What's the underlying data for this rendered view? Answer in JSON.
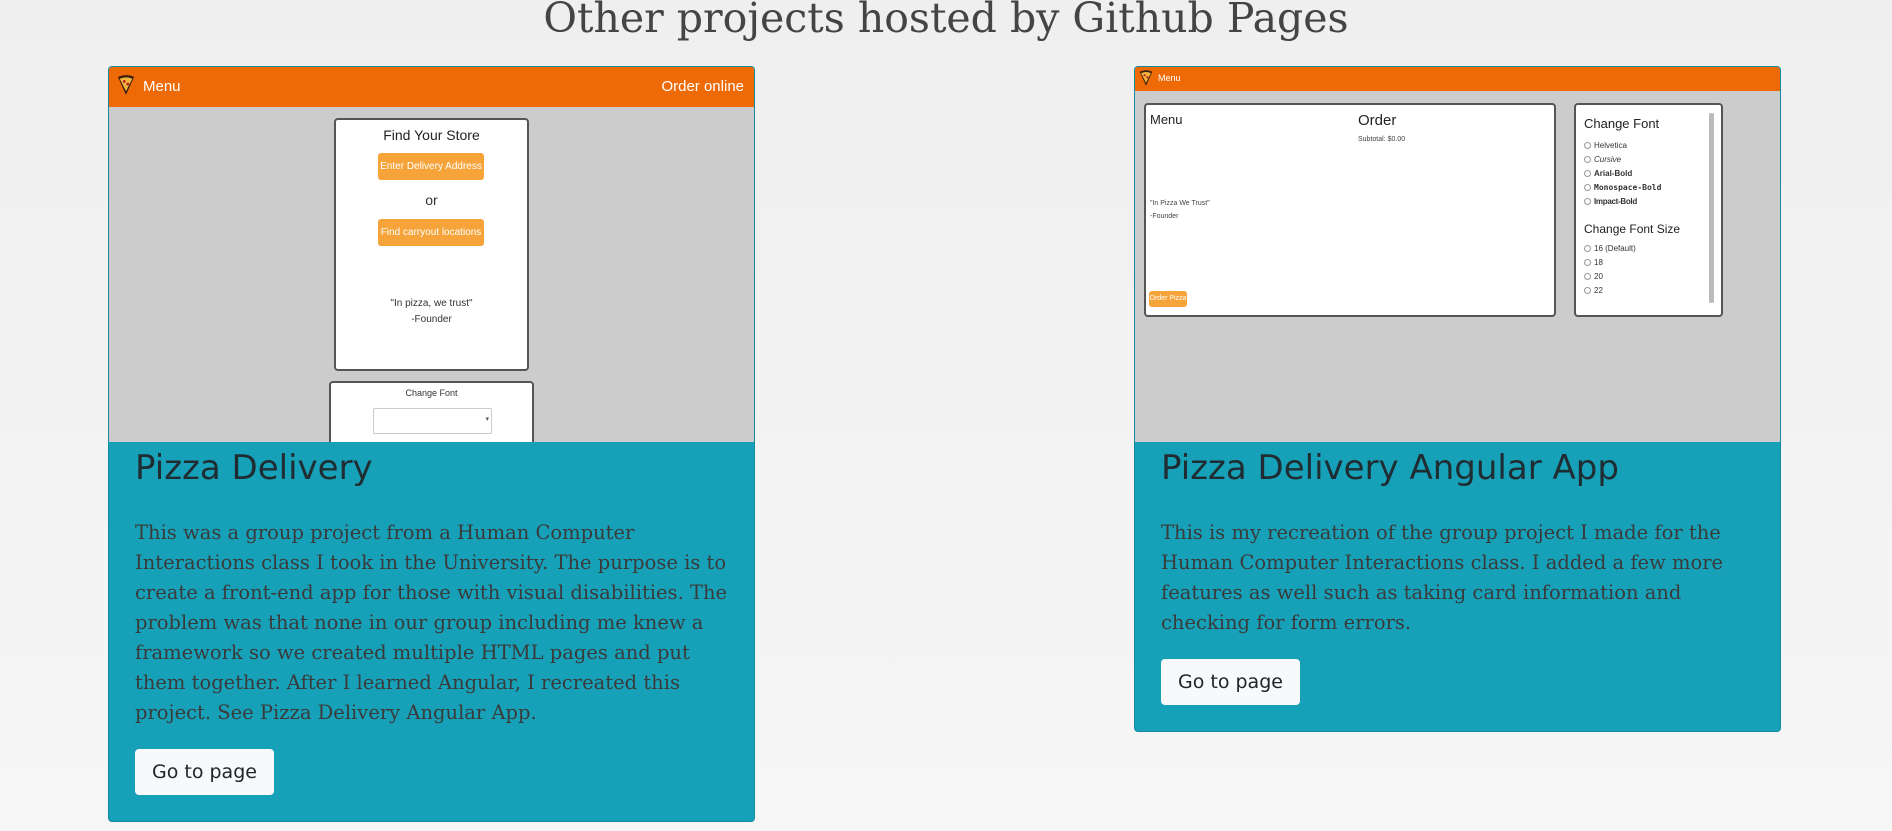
{
  "page": {
    "heading": "Other projects hosted by Github Pages"
  },
  "projects": [
    {
      "title": "Pizza Delivery",
      "description": "This was a group project from a Human Computer Interactions class I took in the University. The purpose is to create a front-end app for those with visual disabilities. The problem was that none in our group including me knew a framework so we created multiple HTML pages and put them together. After I learned Angular, I recreated this project. See Pizza Delivery Angular App.",
      "button": "Go to page",
      "preview": {
        "nav_menu": "Menu",
        "nav_order": "Order online",
        "store_title": "Find Your Store",
        "delivery_button": "Enter Delivery Address",
        "or_text": "or",
        "carryout_button": "Find carryout locations",
        "quote": "\"In pizza, we trust\"",
        "quote_author": "-Founder",
        "font_panel_title": "Change Font"
      }
    },
    {
      "title": "Pizza Delivery Angular App",
      "description": "This is my recreation of the group project I made for the Human Computer Interactions class. I added a few more features as well such as taking card information and checking for form errors.",
      "button": "Go to page",
      "preview": {
        "nav_menu": "Menu",
        "menu_title": "Menu",
        "order_title": "Order",
        "subtotal": "Subtotal: $0.00",
        "quote": "\"In Pizza We Trust\"",
        "quote_author": "-Founder",
        "order_button": "Order Pizza",
        "font_title": "Change Font",
        "fonts": [
          "Helvetica",
          "Cursive",
          "Arial-Bold",
          "Monospace-Bold",
          "Impact-Bold"
        ],
        "size_title": "Change Font Size",
        "sizes": [
          "16 (Default)",
          "18",
          "20",
          "22"
        ]
      }
    }
  ],
  "colors": {
    "card": "#17a1b8",
    "navbar": "#ee6a06",
    "mini_button": "#f6a33a"
  }
}
